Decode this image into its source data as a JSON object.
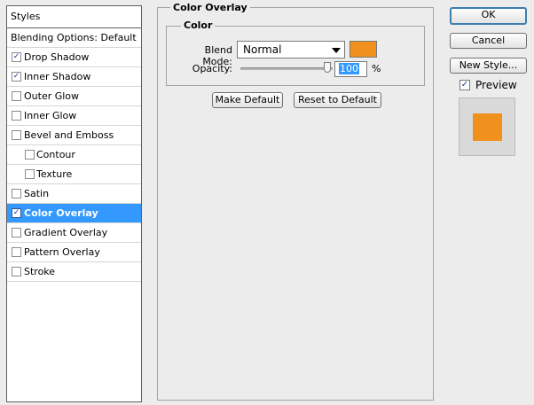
{
  "styles_list": {
    "header": "Styles",
    "blending_options": "Blending Options: Default",
    "items": [
      {
        "label": "Drop Shadow",
        "checked": true
      },
      {
        "label": "Inner Shadow",
        "checked": true
      },
      {
        "label": "Outer Glow",
        "checked": false
      },
      {
        "label": "Inner Glow",
        "checked": false
      },
      {
        "label": "Bevel and Emboss",
        "checked": false
      },
      {
        "label": "Contour",
        "checked": false
      },
      {
        "label": "Texture",
        "checked": false
      },
      {
        "label": "Satin",
        "checked": false
      },
      {
        "label": "Color Overlay",
        "checked": true,
        "selected": true
      },
      {
        "label": "Gradient Overlay",
        "checked": false
      },
      {
        "label": "Pattern Overlay",
        "checked": false
      },
      {
        "label": "Stroke",
        "checked": false
      }
    ]
  },
  "panel": {
    "title": "Color Overlay",
    "group_title": "Color",
    "blend_mode_label": "Blend Mode:",
    "blend_mode_value": "Normal",
    "overlay_color": "#f0901d",
    "opacity_label": "Opacity:",
    "opacity_value": "100",
    "opacity_unit": "%",
    "make_default": "Make Default",
    "reset_default": "Reset to Default"
  },
  "actions": {
    "ok": "OK",
    "cancel": "Cancel",
    "new_style": "New Style...",
    "preview_label": "Preview",
    "preview_checked": true
  },
  "colors": {
    "selection": "#3399ff",
    "swatch": "#f0901d"
  }
}
